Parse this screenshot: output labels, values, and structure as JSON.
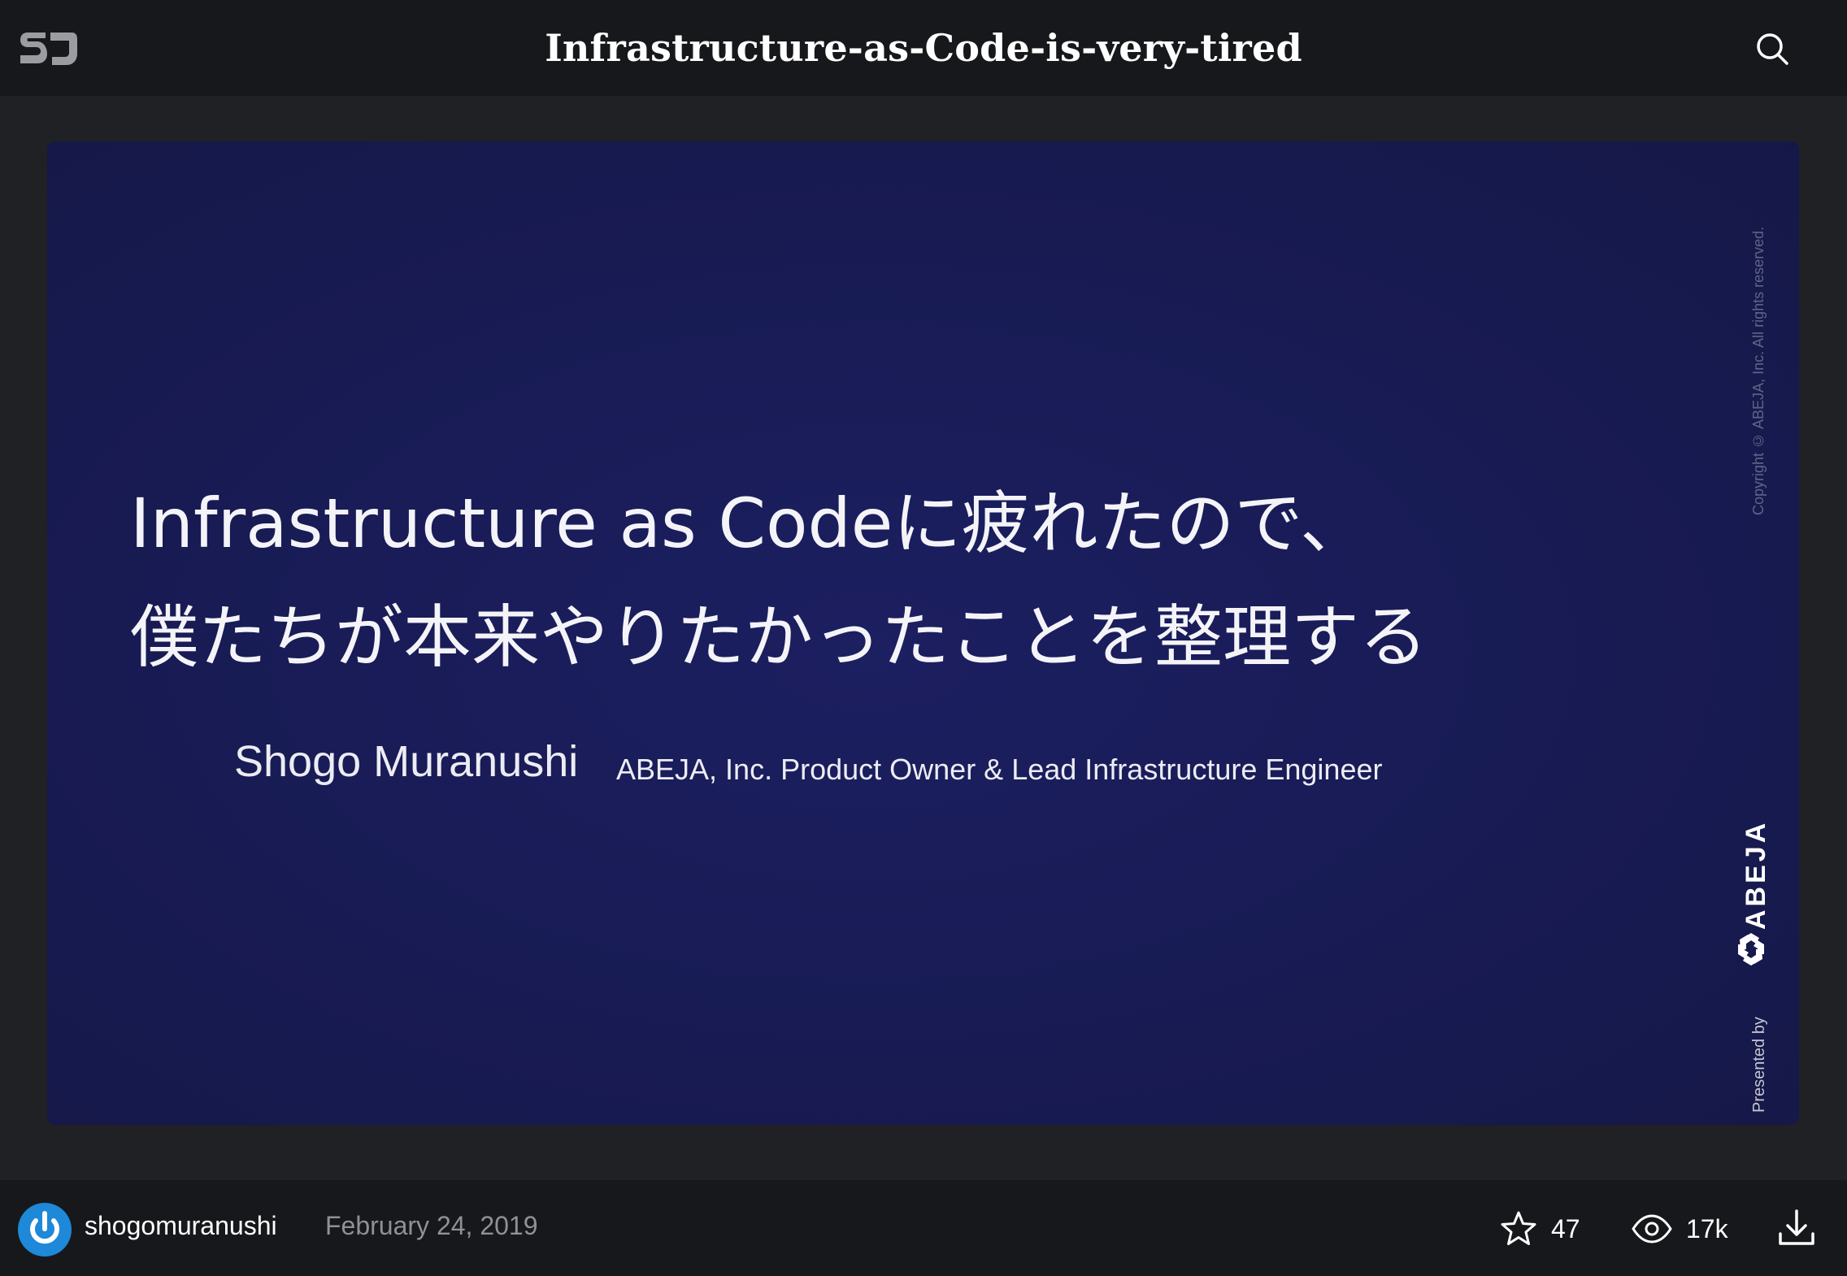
{
  "header": {
    "logo_icon": "speakerdeck-logo-icon",
    "title": "Infrastructure-as-Code-is-very-tired",
    "search_icon": "search-icon"
  },
  "slide": {
    "title_line1": "Infrastructure as Codeに疲れたので、",
    "title_line2": "僕たちが本来やりたかったことを整理する",
    "author": "Shogo Muranushi",
    "role": "ABEJA, Inc. Product Owner & Lead Infrastructure Engineer",
    "copyright": "Copyright © ABEJA, Inc. All rights reserved.",
    "presented_by": "Presented by",
    "brand": "ABEJA",
    "background_color": "#191c57"
  },
  "footer": {
    "avatar_icon": "power-icon",
    "username": "shogomuranushi",
    "date": "February 24, 2019",
    "stars": "47",
    "star_icon": "star-icon",
    "views": "17k",
    "view_icon": "eye-icon",
    "download_icon": "download-icon"
  },
  "colors": {
    "bar": "#17181b",
    "page": "#202124",
    "accent": "#1e88d9"
  }
}
